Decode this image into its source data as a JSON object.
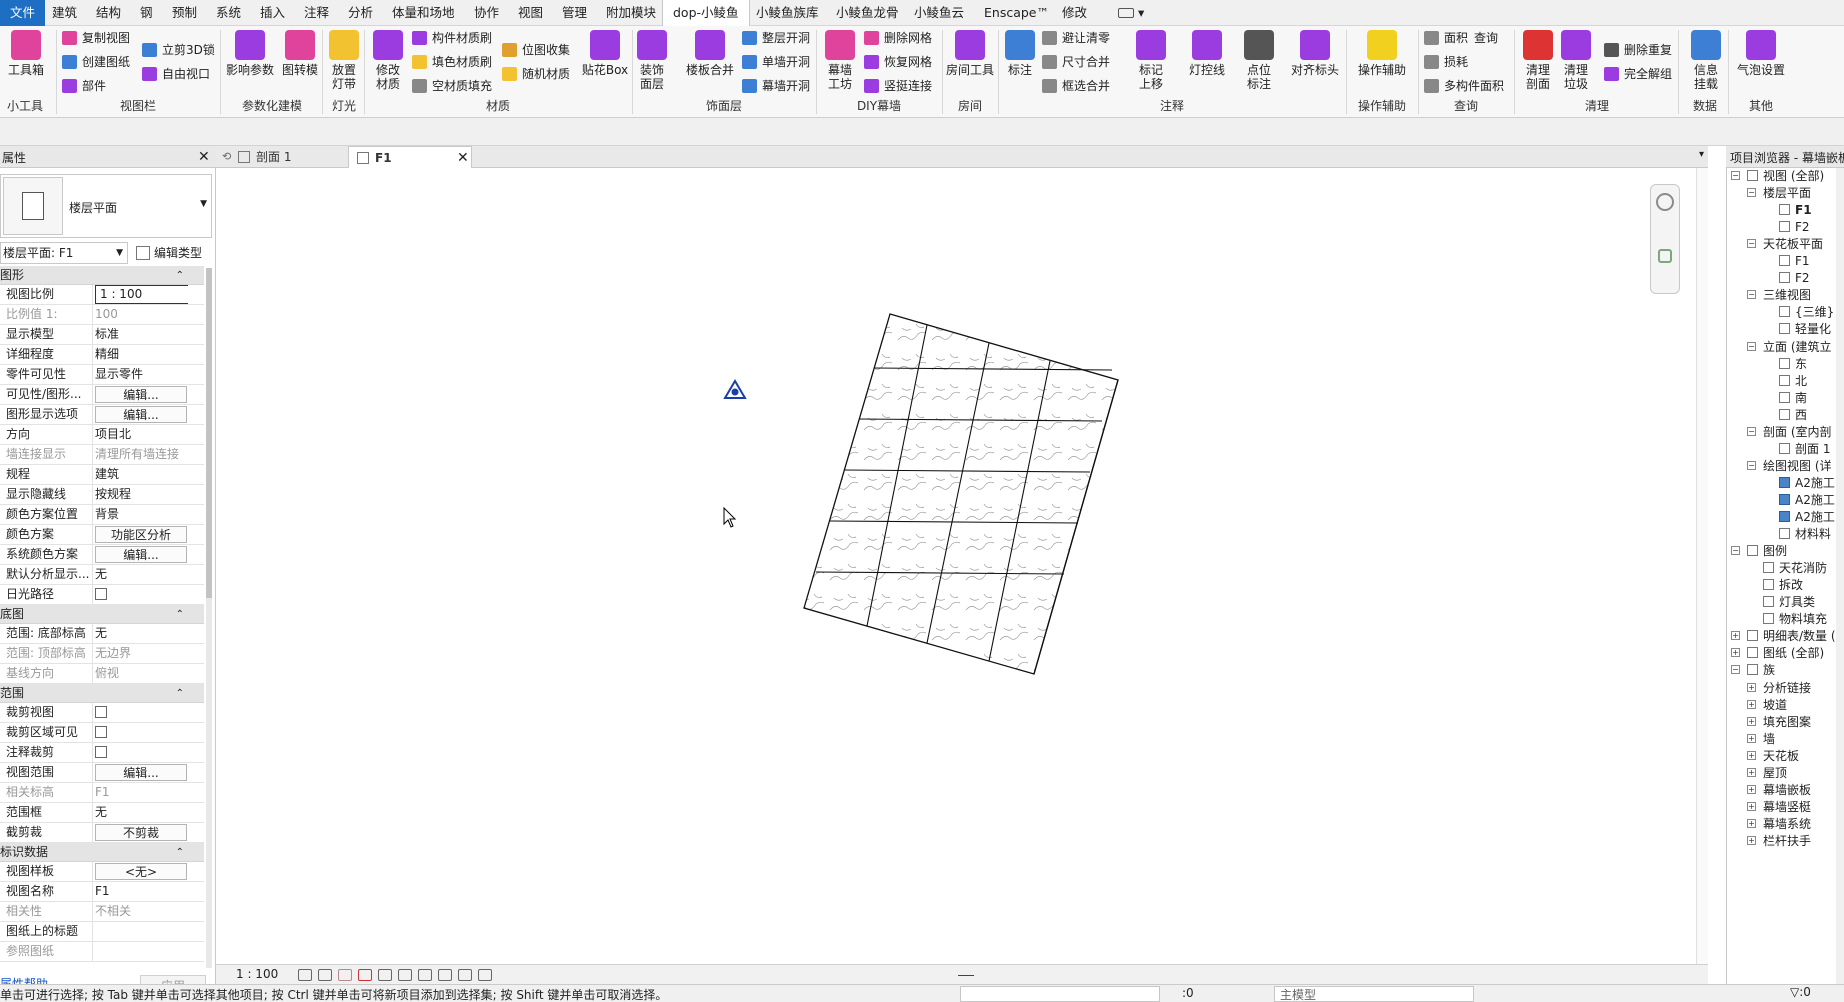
{
  "menu_tabs": [
    {
      "label": "文件"
    },
    {
      "label": "建筑"
    },
    {
      "label": "结构"
    },
    {
      "label": "钢"
    },
    {
      "label": "预制"
    },
    {
      "label": "系统"
    },
    {
      "label": "插入"
    },
    {
      "label": "注释"
    },
    {
      "label": "分析"
    },
    {
      "label": "体量和场地"
    },
    {
      "label": "协作"
    },
    {
      "label": "视图"
    },
    {
      "label": "管理"
    },
    {
      "label": "附加模块"
    },
    {
      "label": "dop-小鲮鱼"
    },
    {
      "label": "小鲮鱼族库"
    },
    {
      "label": "小鲮鱼龙骨"
    },
    {
      "label": "小鲮鱼云"
    },
    {
      "label": "Enscape™"
    },
    {
      "label": "修改"
    }
  ],
  "ribbon": {
    "toolbox": "工具箱",
    "copy_view": "复制视图",
    "create_drawing": "创建图纸",
    "part": "部件",
    "crop_3d_lock": "立剪3D锁",
    "free_viewport": "自由视口",
    "shadow_param": "影响参数",
    "shift_model": "图转模",
    "place": "放置",
    "light_strip": "灯带",
    "modify": "修改",
    "material": "材质",
    "comp_material_brush": "构件材质刷",
    "fill_material_brush": "填色材质刷",
    "void_material_fill": "空材质填充",
    "position_collect": "位图收集",
    "random_material": "随机材质",
    "sticker_box": "贴花Box",
    "deco_surface": "装饰",
    "deco_layer": "面层",
    "floor_merge": "楼板合并",
    "whole_layer_open": "整层开洞",
    "single_wall_open": "单墙开洞",
    "curtain_open": "幕墙开洞",
    "curtain_wall": "幕墙",
    "work_shop": "工坊",
    "delete_grid": "删除网格",
    "restore_grid": "恢复网格",
    "mullion_connect": "竖挺连接",
    "room_tool": "房间工具",
    "dim": "标注",
    "avoid_overlap": "避让清零",
    "dim_merge": "尺寸合并",
    "frame_merge": "框选合并",
    "tag": "标记",
    "tag_up": "上移",
    "light_control": "灯控线",
    "point": "点位",
    "point_tag": "标注",
    "align_tag": "对齐标头",
    "op_assist": "操作辅助",
    "area": "面积",
    "query": "查询",
    "loss": "损耗",
    "multi_area": "多构件面积",
    "clear": "清理",
    "section": "剖面",
    "clear2": "清理",
    "garbage": "垃圾",
    "delete_dup": "删除重复",
    "full_unlock": "完全解组",
    "info": "信息",
    "mount": "挂载",
    "bubble_settings": "气泡设置"
  },
  "ribbon_groups": [
    {
      "label": "小工具"
    },
    {
      "label": "视图栏"
    },
    {
      "label": "参数化建模"
    },
    {
      "label": "灯光"
    },
    {
      "label": "材质"
    },
    {
      "label": "饰面层"
    },
    {
      "label": "DIY幕墙"
    },
    {
      "label": "房间"
    },
    {
      "label": "注释"
    },
    {
      "label": "操作辅助"
    },
    {
      "label": "查询"
    },
    {
      "label": "清理"
    },
    {
      "label": "数据"
    },
    {
      "label": "其他"
    }
  ],
  "properties": {
    "title": "属性",
    "type_name": "楼层平面",
    "instance": "楼层平面: F1",
    "edit_type": "编辑类型",
    "sections": [
      {
        "title": "图形",
        "rows": [
          {
            "name": "视图比例",
            "value": "1 : 100",
            "kind": "input"
          },
          {
            "name": "比例值 1:",
            "value": "100",
            "kind": "dim"
          },
          {
            "name": "显示模型",
            "value": "标准",
            "kind": "text"
          },
          {
            "name": "详细程度",
            "value": "精细",
            "kind": "text"
          },
          {
            "name": "零件可见性",
            "value": "显示零件",
            "kind": "text"
          },
          {
            "name": "可见性/图形...",
            "value": "编辑...",
            "kind": "button"
          },
          {
            "name": "图形显示选项",
            "value": "编辑...",
            "kind": "button"
          },
          {
            "name": "方向",
            "value": "项目北",
            "kind": "text"
          },
          {
            "name": "墙连接显示",
            "value": "清理所有墙连接",
            "kind": "dim"
          },
          {
            "name": "规程",
            "value": "建筑",
            "kind": "text"
          },
          {
            "name": "显示隐藏线",
            "value": "按规程",
            "kind": "text"
          },
          {
            "name": "颜色方案位置",
            "value": "背景",
            "kind": "text"
          },
          {
            "name": "颜色方案",
            "value": "功能区分析",
            "kind": "button"
          },
          {
            "name": "系统颜色方案",
            "value": "编辑...",
            "kind": "button"
          },
          {
            "name": "默认分析显示...",
            "value": "无",
            "kind": "text"
          },
          {
            "name": "日光路径",
            "value": "",
            "kind": "checkbox"
          }
        ]
      },
      {
        "title": "底图",
        "rows": [
          {
            "name": "范围: 底部标高",
            "value": "无",
            "kind": "text"
          },
          {
            "name": "范围: 顶部标高",
            "value": "无边界",
            "kind": "dim"
          },
          {
            "name": "基线方向",
            "value": "俯视",
            "kind": "dim"
          }
        ]
      },
      {
        "title": "范围",
        "rows": [
          {
            "name": "裁剪视图",
            "value": "",
            "kind": "checkbox"
          },
          {
            "name": "裁剪区域可见",
            "value": "",
            "kind": "checkbox"
          },
          {
            "name": "注释裁剪",
            "value": "",
            "kind": "checkbox"
          },
          {
            "name": "视图范围",
            "value": "编辑...",
            "kind": "button"
          },
          {
            "name": "相关标高",
            "value": "F1",
            "kind": "dim"
          },
          {
            "name": "范围框",
            "value": "无",
            "kind": "text"
          },
          {
            "name": "截剪裁",
            "value": "不剪裁",
            "kind": "button"
          }
        ]
      },
      {
        "title": "标识数据",
        "rows": [
          {
            "name": "视图样板",
            "value": "<无>",
            "kind": "button"
          },
          {
            "name": "视图名称",
            "value": "F1",
            "kind": "text"
          },
          {
            "name": "相关性",
            "value": "不相关",
            "kind": "dim"
          },
          {
            "name": "图纸上的标题",
            "value": "",
            "kind": "text"
          },
          {
            "name": "参照图纸",
            "value": "",
            "kind": "dim"
          }
        ]
      }
    ],
    "help": "属性帮助",
    "apply": "应用"
  },
  "doc_tabs": [
    {
      "label": "剖面 1",
      "active": false
    },
    {
      "label": "F1",
      "active": true
    }
  ],
  "view_control": {
    "scale": "1 : 100"
  },
  "project_browser": {
    "title": "项目浏览器 - 幕墙嵌板",
    "items": [
      {
        "label": "视图 (全部)",
        "level": 0,
        "toggle": "-",
        "icon": "view"
      },
      {
        "label": "楼层平面",
        "level": 1,
        "toggle": "-",
        "icon": ""
      },
      {
        "label": "F1",
        "level": 2,
        "toggle": "",
        "icon": "plan",
        "selected": true
      },
      {
        "label": "F2",
        "level": 2,
        "toggle": "",
        "icon": "plan"
      },
      {
        "label": "天花板平面",
        "level": 1,
        "toggle": "-",
        "icon": ""
      },
      {
        "label": "F1",
        "level": 2,
        "toggle": "",
        "icon": "plan"
      },
      {
        "label": "F2",
        "level": 2,
        "toggle": "",
        "icon": "plan"
      },
      {
        "label": "三维视图",
        "level": 1,
        "toggle": "-",
        "icon": ""
      },
      {
        "label": "{三维}",
        "level": 2,
        "toggle": "",
        "icon": "plan"
      },
      {
        "label": "轻量化",
        "level": 2,
        "toggle": "",
        "icon": "plan"
      },
      {
        "label": "立面 (建筑立",
        "level": 1,
        "toggle": "-",
        "icon": ""
      },
      {
        "label": "东",
        "level": 2,
        "toggle": "",
        "icon": "plan"
      },
      {
        "label": "北",
        "level": 2,
        "toggle": "",
        "icon": "plan"
      },
      {
        "label": "南",
        "level": 2,
        "toggle": "",
        "icon": "plan"
      },
      {
        "label": "西",
        "level": 2,
        "toggle": "",
        "icon": "plan"
      },
      {
        "label": "剖面 (室内剖",
        "level": 1,
        "toggle": "-",
        "icon": ""
      },
      {
        "label": "剖面 1",
        "level": 2,
        "toggle": "",
        "icon": "plan"
      },
      {
        "label": "绘图视图 (详",
        "level": 1,
        "toggle": "-",
        "icon": ""
      },
      {
        "label": "A2施工",
        "level": 2,
        "toggle": "",
        "icon": "filled"
      },
      {
        "label": "A2施工",
        "level": 2,
        "toggle": "",
        "icon": "filled"
      },
      {
        "label": "A2施工",
        "level": 2,
        "toggle": "",
        "icon": "filled"
      },
      {
        "label": "材料料",
        "level": 2,
        "toggle": "",
        "icon": "plan"
      },
      {
        "label": "图例",
        "level": 0,
        "toggle": "-",
        "icon": "legend"
      },
      {
        "label": "天花消防",
        "level": 1,
        "toggle": "",
        "icon": "plan"
      },
      {
        "label": "拆改",
        "level": 1,
        "toggle": "",
        "icon": "plan"
      },
      {
        "label": "灯具类",
        "level": 1,
        "toggle": "",
        "icon": "plan"
      },
      {
        "label": "物料填充",
        "level": 1,
        "toggle": "",
        "icon": "plan"
      },
      {
        "label": "明细表/数量 (",
        "level": 0,
        "toggle": "+",
        "icon": "table"
      },
      {
        "label": "图纸 (全部)",
        "level": 0,
        "toggle": "+",
        "icon": "sheet"
      },
      {
        "label": "族",
        "level": 0,
        "toggle": "-",
        "icon": "family"
      },
      {
        "label": "分析链接",
        "level": 1,
        "toggle": "+",
        "icon": ""
      },
      {
        "label": "坡道",
        "level": 1,
        "toggle": "+",
        "icon": ""
      },
      {
        "label": "填充图案",
        "level": 1,
        "toggle": "+",
        "icon": ""
      },
      {
        "label": "墙",
        "level": 1,
        "toggle": "+",
        "icon": ""
      },
      {
        "label": "天花板",
        "level": 1,
        "toggle": "+",
        "icon": ""
      },
      {
        "label": "屋顶",
        "level": 1,
        "toggle": "+",
        "icon": ""
      },
      {
        "label": "幕墙嵌板",
        "level": 1,
        "toggle": "+",
        "icon": ""
      },
      {
        "label": "幕墙竖梃",
        "level": 1,
        "toggle": "+",
        "icon": ""
      },
      {
        "label": "幕墙系统",
        "level": 1,
        "toggle": "+",
        "icon": ""
      },
      {
        "label": "栏杆扶手",
        "level": 1,
        "toggle": "+",
        "icon": ""
      }
    ]
  },
  "status": {
    "message": "单击可进行选择; 按 Tab 键并单击可选择其他项目; 按 Ctrl 键并单击可将新项目添加到选择集; 按 Shift 键并单击可取消选择。",
    "zero": ":0",
    "model": "主模型"
  },
  "colors": {
    "accent": "#1e6fc4",
    "ribbon_purple": "#9b3ce0",
    "ribbon_pink": "#e0439b",
    "ribbon_blue": "#3d7fd4"
  }
}
